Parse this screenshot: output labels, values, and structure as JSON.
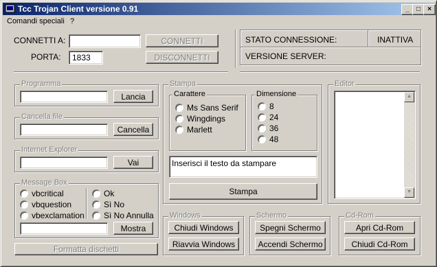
{
  "window": {
    "title": "Tcc Trojan Client versione 0.91"
  },
  "menu": {
    "items": [
      "Comandi speciali",
      "?"
    ]
  },
  "connection": {
    "connect_label": "CONNETTI A:",
    "connect_value": "",
    "port_label": "PORTA:",
    "port_value": "1833",
    "connect_button": "CONNETTI",
    "disconnect_button": "DISCONNETTI"
  },
  "status": {
    "state_label": "STATO CONNESSIONE:",
    "state_value": "INATTIVA",
    "server_label": "VERSIONE SERVER:",
    "server_value": ""
  },
  "programma": {
    "title": "Programma",
    "button": "Lancia"
  },
  "cancella": {
    "title": "Cancella file",
    "button": "Cancella"
  },
  "explorer": {
    "title": "Internet Explorer",
    "button": "Vai"
  },
  "messagebox": {
    "title": "Message Box",
    "styles": [
      "vbcritical",
      "vbquestion",
      "vbexclamation"
    ],
    "buttons": [
      "Ok",
      "Sì No",
      "Sì No Annulla"
    ],
    "show_button": "Mostra"
  },
  "format_button": "Formatta dischetti",
  "stampa": {
    "title": "Stampa",
    "carattere_title": "Carattere",
    "fonts": [
      "Ms Sans Serif",
      "Wingdings",
      "Marlett"
    ],
    "dimensione_title": "Dimensione",
    "sizes": [
      "8",
      "24",
      "36",
      "48"
    ],
    "text_value": "Inserisci il testo da stampare",
    "print_button": "Stampa"
  },
  "editor": {
    "title": "Editor"
  },
  "windows": {
    "title": "Windows",
    "close_button": "Chiudi Windows",
    "restart_button": "Riavvia Windows"
  },
  "schermo": {
    "title": "Schermo",
    "off_button": "Spegni Schermo",
    "on_button": "Accendi Schermo"
  },
  "cdrom": {
    "title": "Cd-Rom",
    "open_button": "Apri Cd-Rom",
    "close_button": "Chiudi Cd-Rom"
  }
}
